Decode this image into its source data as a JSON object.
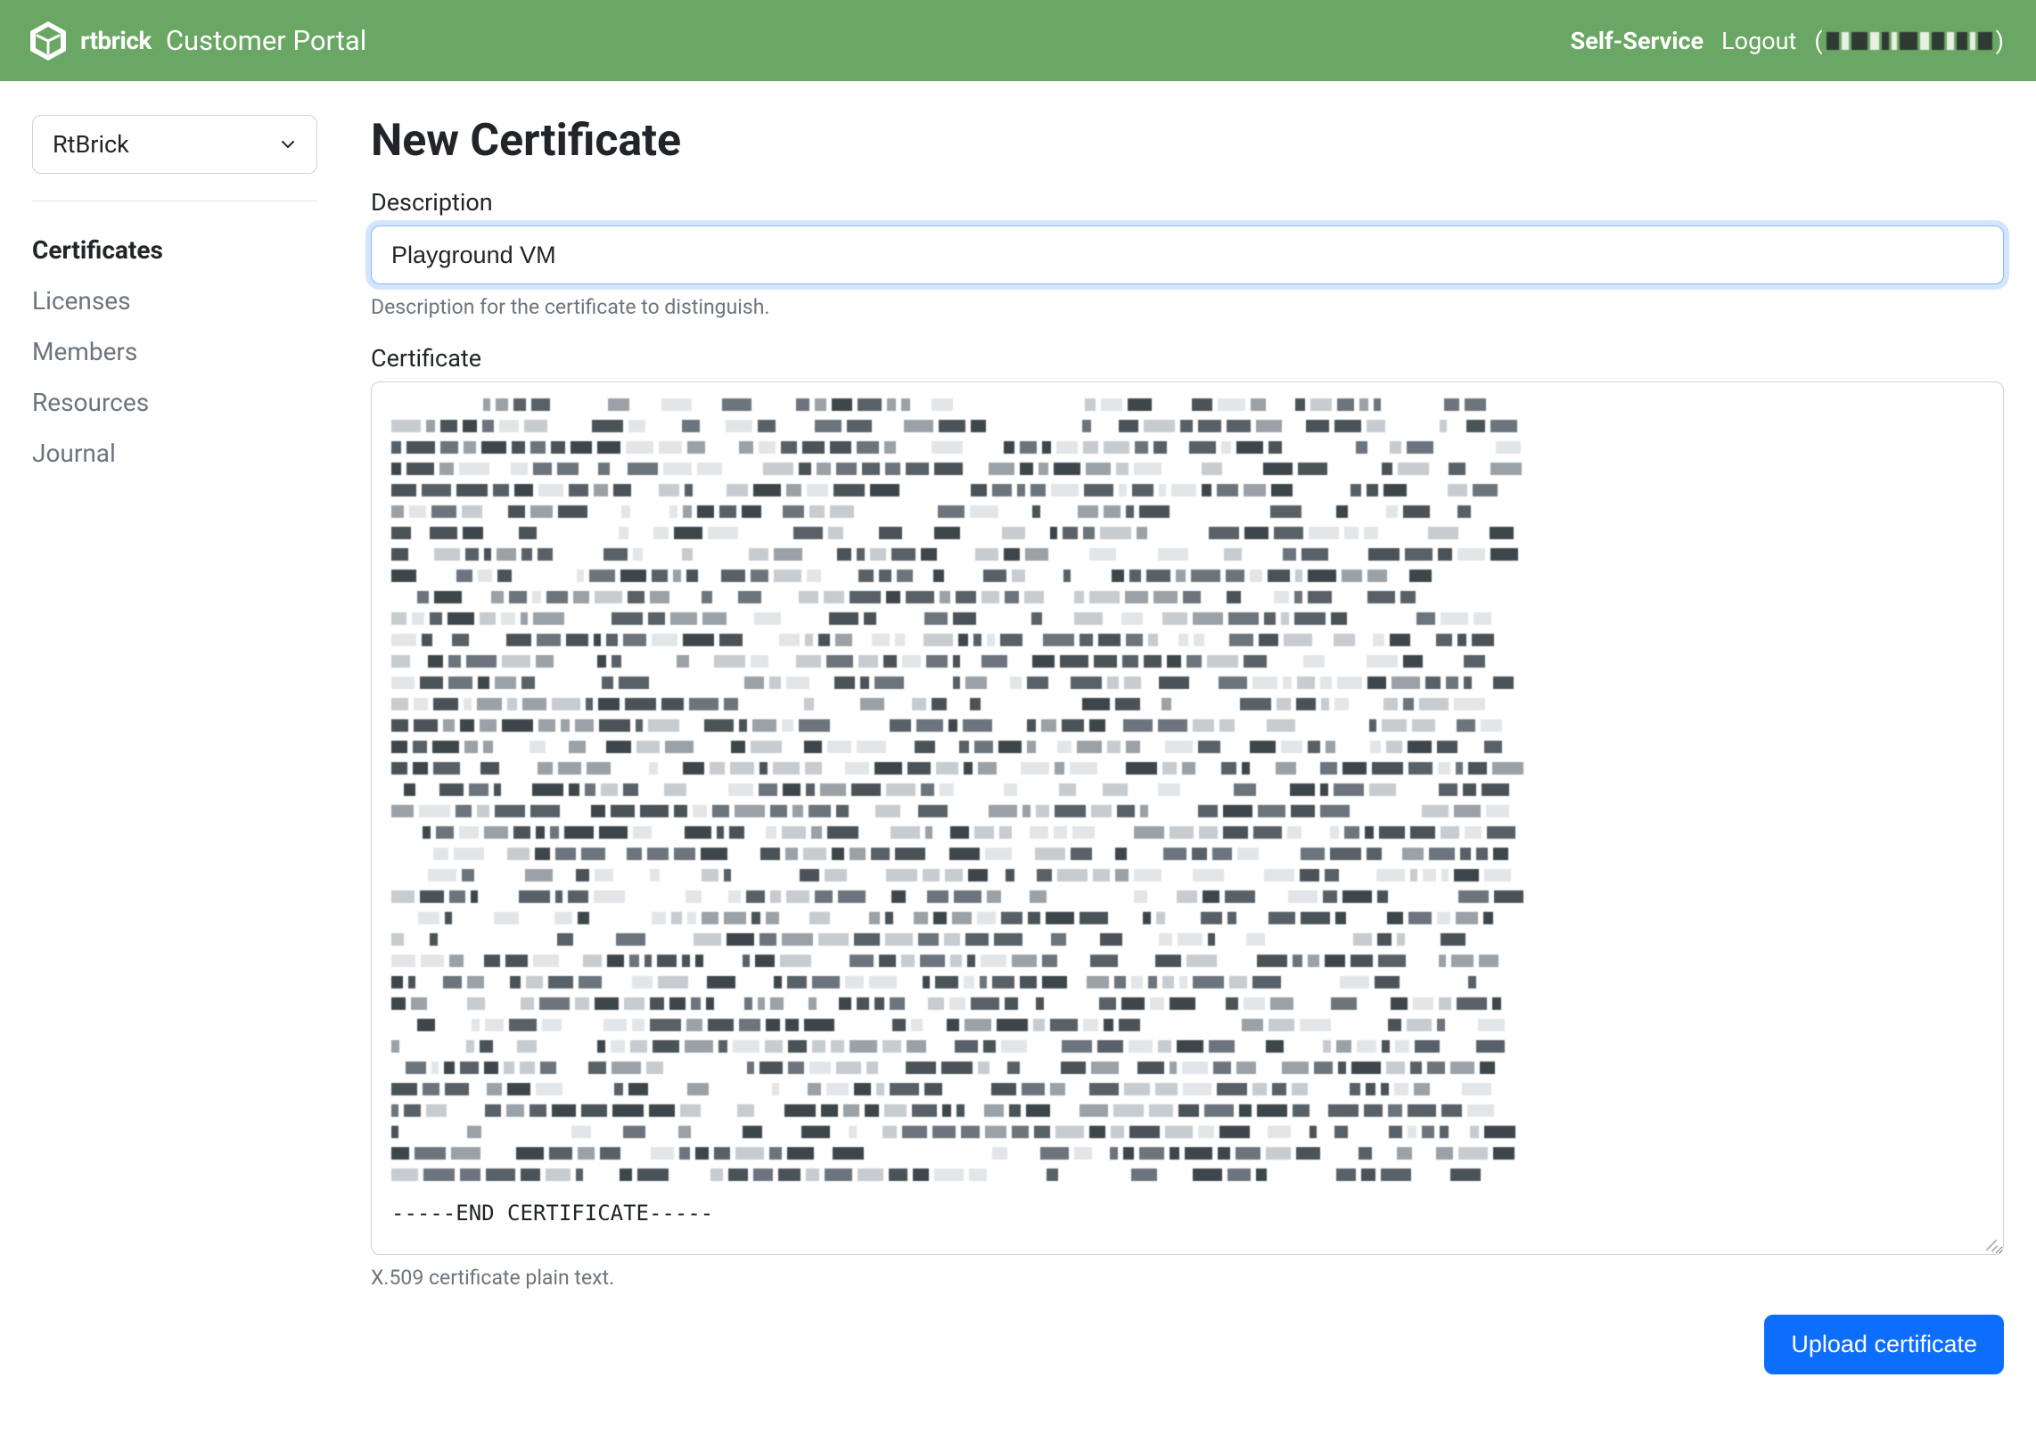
{
  "header": {
    "brand_name": "rtbrick",
    "app_name": "Customer Portal",
    "nav": {
      "self_service": "Self-Service",
      "logout": "Logout"
    }
  },
  "sidebar": {
    "org_selected": "RtBrick",
    "items": [
      {
        "key": "certificates",
        "label": "Certificates",
        "active": true
      },
      {
        "key": "licenses",
        "label": "Licenses",
        "active": false
      },
      {
        "key": "members",
        "label": "Members",
        "active": false
      },
      {
        "key": "resources",
        "label": "Resources",
        "active": false
      },
      {
        "key": "journal",
        "label": "Journal",
        "active": false
      }
    ]
  },
  "page": {
    "title": "New Certificate",
    "description": {
      "label": "Description",
      "value": "Playground VM",
      "help": "Description for the certificate to distinguish."
    },
    "certificate": {
      "label": "Certificate",
      "footer_line": "-----END CERTIFICATE-----",
      "help": "X.509 certificate plain text."
    },
    "actions": {
      "upload": "Upload certificate"
    }
  }
}
